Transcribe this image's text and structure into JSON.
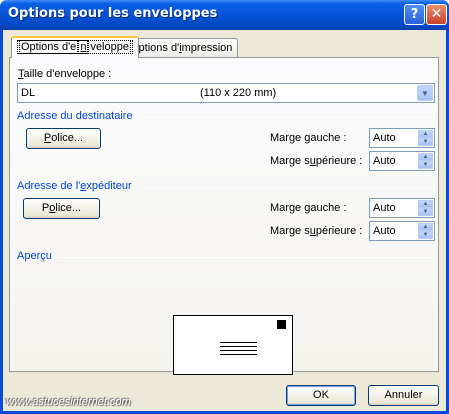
{
  "window": {
    "title": "Options pour les enveloppes"
  },
  "tabs": [
    {
      "label_pre": "Options d'e",
      "label_hot": "n",
      "label_post": "veloppe"
    },
    {
      "label_pre": "Options d'",
      "label_hot": "i",
      "label_post": "mpression"
    }
  ],
  "envelope_size": {
    "label_hot": "T",
    "label_post": "aille d'enveloppe :",
    "value": "DL",
    "dimensions": "(110 x 220 mm)"
  },
  "recipient": {
    "group_label": "Adresse du destinataire",
    "font_button_hot": "P",
    "font_button_post": "olice...",
    "left_margin_pre": "Marge ",
    "left_margin_hot": "g",
    "left_margin_post": "auche :",
    "left_margin_value": "Auto",
    "top_margin_pre": "Marge s",
    "top_margin_hot": "u",
    "top_margin_post": "périeure :",
    "top_margin_value": "Auto"
  },
  "sender": {
    "group_label_pre": "Adresse de l'",
    "group_label_hot": "e",
    "group_label_post": "xpéditeur",
    "font_button_pre": "P",
    "font_button_hot": "o",
    "font_button_post": "lice...",
    "left_margin_pre": "Marge ",
    "left_margin_hot": "g",
    "left_margin_post": "auche :",
    "left_margin_value": "Auto",
    "top_margin_pre": "Marge s",
    "top_margin_hot": "u",
    "top_margin_post": "périeure :",
    "top_margin_value": "Auto"
  },
  "preview": {
    "label": "Aperçu"
  },
  "buttons": {
    "ok": "OK",
    "cancel": "Annuler"
  },
  "watermark": "www.astucesinternet.com",
  "colors": {
    "group_label": "#0046d5",
    "title_bar": "#0553d6",
    "dialog_bg": "#ece9d8"
  }
}
